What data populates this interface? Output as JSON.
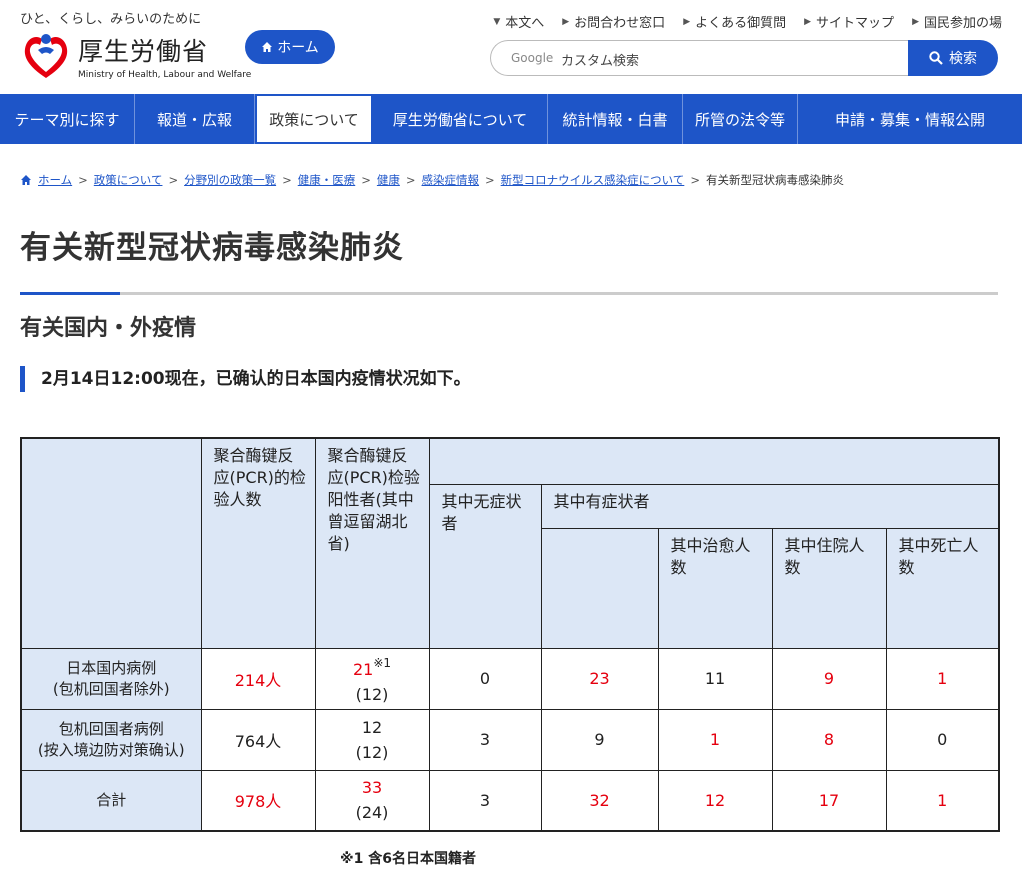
{
  "header": {
    "tagline": "ひと、くらし、みらいのために",
    "logo_name": "厚生労働省",
    "logo_en": "Ministry of Health, Labour and Welfare",
    "home_label": "ホーム",
    "top_links": [
      "本文へ",
      "お問合わせ窓口",
      "よくある御質問",
      "サイトマップ",
      "国民参加の場"
    ],
    "search_google": "Google",
    "search_placeholder": "カスタム検索",
    "search_button": "検索"
  },
  "nav": [
    "テーマ別に探す",
    "報道・広報",
    "政策について",
    "厚生労働省について",
    "統計情報・白書",
    "所管の法令等",
    "申請・募集・情報公開"
  ],
  "nav_active_index": 2,
  "breadcrumb": [
    "ホーム",
    "政策について",
    "分野別の政策一覧",
    "健康・医療",
    "健康",
    "感染症情報",
    "新型コロナウイルス感染症について",
    "有关新型冠状病毒感染肺炎"
  ],
  "page_title": "有关新型冠状病毒感染肺炎",
  "section_title": "有关国内・外疫情",
  "lead": "2月14日12:00现在，已确认的日本国内疫情状况如下。",
  "table": {
    "headers": {
      "pcr_tested": "聚合酶键反应(PCR)的检验人数",
      "pcr_positive": "聚合酶键反应(PCR)检验阳性者(其中曾逗留湖北省)",
      "asymptomatic": "其中无症状者",
      "symptomatic": "其中有症状者",
      "recovered": "其中治愈人数",
      "hospitalized": "其中住院人数",
      "deaths": "其中死亡人数"
    },
    "rows": [
      {
        "label1": "日本国内病例",
        "label2": "(包机回国者除外)",
        "tested": "214人",
        "positive": "21",
        "positive_note": "※1",
        "positive_hubei": "(12)",
        "asymptomatic": "0",
        "symptomatic": "23",
        "recovered": "11",
        "hospitalized": "9",
        "deaths": "1"
      },
      {
        "label1": "包机回国者病例",
        "label2": "(按入境边防对策确认)",
        "tested": "764人",
        "positive": "12",
        "positive_note": "",
        "positive_hubei": "(12)",
        "asymptomatic": "3",
        "symptomatic": "9",
        "recovered": "1",
        "hospitalized": "8",
        "deaths": "0"
      },
      {
        "label1": "合計",
        "label2": "",
        "tested": "978人",
        "positive": "33",
        "positive_note": "",
        "positive_hubei": "(24)",
        "asymptomatic": "3",
        "symptomatic": "32",
        "recovered": "12",
        "hospitalized": "17",
        "deaths": "1"
      }
    ]
  },
  "footnote": "※1  含6名日本国籍者",
  "colors": {
    "brand_blue": "#1e55c8",
    "header_cell": "#dce7f6",
    "highlight_red": "#e5000f"
  }
}
